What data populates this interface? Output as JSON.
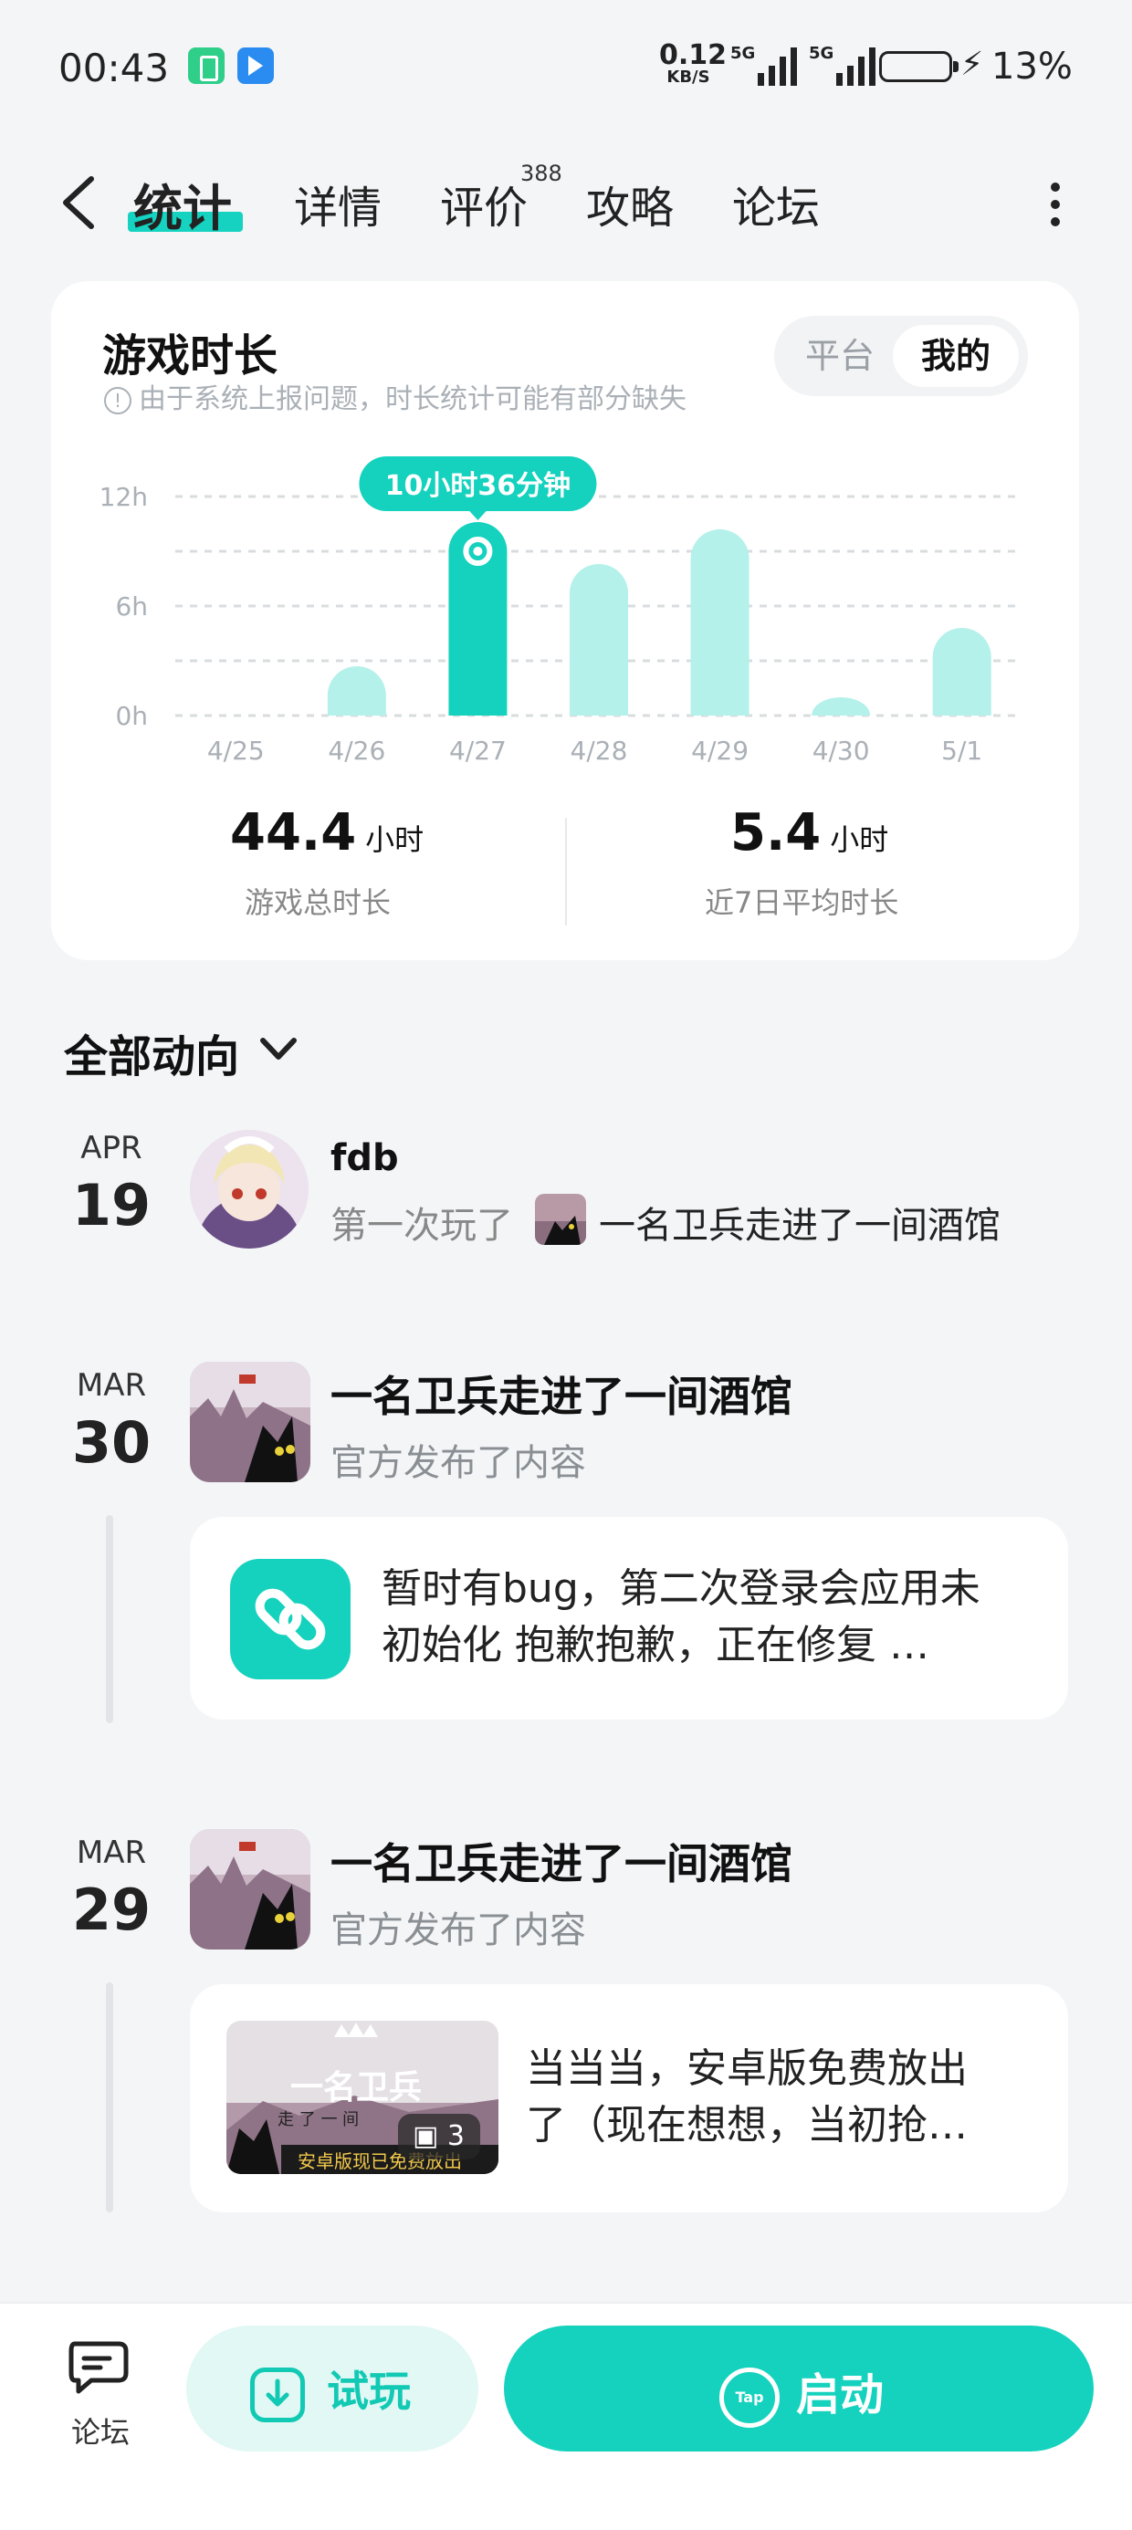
{
  "status_bar": {
    "time": "00:43",
    "net_speed_value": "0.12",
    "net_speed_unit": "KB/S",
    "signal_1_label": "5G",
    "signal_2_label": "5G",
    "battery_percent": "13%",
    "charging": true
  },
  "nav": {
    "tabs": [
      "统计",
      "详情",
      "评价",
      "攻略",
      "论坛"
    ],
    "active_tab_index": 0,
    "review_count_badge": "388"
  },
  "stats_card": {
    "title": "游戏时长",
    "note": "由于系统上报问题，时长统计可能有部分缺失",
    "toggle_platform": "平台",
    "toggle_mine": "我的",
    "toggle_selected": "我的",
    "tooltip": "10小时36分钟",
    "total_value": "44.4",
    "total_unit": "小时",
    "total_label": "游戏总时长",
    "avg_value": "5.4",
    "avg_unit": "小时",
    "avg_label": "近7日平均时长"
  },
  "chart_data": {
    "type": "bar",
    "categories": [
      "4/25",
      "4/26",
      "4/27",
      "4/28",
      "4/29",
      "4/30",
      "5/1"
    ],
    "values": [
      0,
      2.7,
      10.6,
      8.3,
      10.2,
      1.0,
      4.8
    ],
    "highlight_index": 2,
    "y_ticks": [
      "0h",
      "6h",
      "12h"
    ],
    "ylim": [
      0,
      12
    ],
    "grid": true,
    "colors": {
      "bar": "#b3f1ea",
      "highlight": "#14d2bd",
      "grid": "#d9dcdf"
    }
  },
  "feed": {
    "filter_label": "全部动向",
    "items": [
      {
        "month": "APR",
        "day": "19",
        "name": "fdb",
        "action": "第一次玩了",
        "game": "一名卫兵走进了一间酒馆"
      },
      {
        "month": "MAR",
        "day": "30",
        "title": "一名卫兵走进了一间酒馆",
        "subtitle": "官方发布了内容",
        "post_line1": "暂时有bug，第二次登录会应用未",
        "post_line2": "初始化 抱歉抱歉，正在修复 …"
      },
      {
        "month": "MAR",
        "day": "29",
        "title": "一名卫兵走进了一间酒馆",
        "subtitle": "官方发布了内容",
        "post_line1": "当当当，安卓版免费放出",
        "post_line2": "了（现在想想，当初抢…",
        "image_count": "3",
        "thumb_title": "一名卫兵",
        "thumb_subtitle": "走 了 一 间",
        "thumb_banner": "安卓版现已免费放出"
      }
    ]
  },
  "bottom_bar": {
    "forum_label": "论坛",
    "trial_label": "试玩",
    "start_label": "启动",
    "tap_logo_text": "Tap"
  }
}
